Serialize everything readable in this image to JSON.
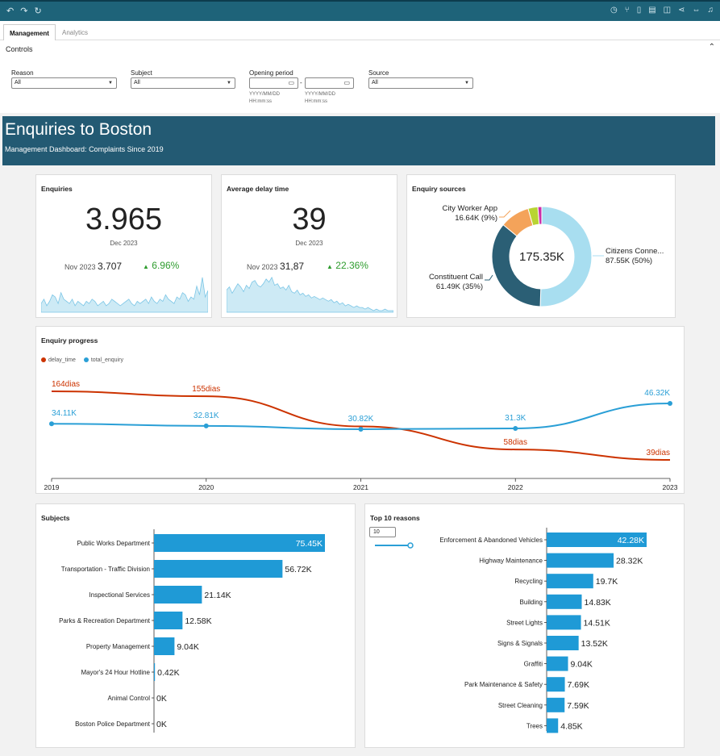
{
  "toolbar": {
    "left_icons": [
      "undo-icon",
      "redo-icon",
      "refresh-icon"
    ],
    "right_icons": [
      "clock-icon",
      "branch-icon",
      "bookmark-icon",
      "file-icon",
      "database-icon",
      "share-icon",
      "fullwidth-icon",
      "bell-icon"
    ]
  },
  "tabs": [
    {
      "label": "Management"
    },
    {
      "label": "Analytics"
    }
  ],
  "controls": {
    "title": "Controls",
    "reason": {
      "label": "Reason",
      "value": "All"
    },
    "subject": {
      "label": "Subject",
      "value": "All"
    },
    "opening": {
      "label": "Opening period",
      "separator": "-",
      "hint1": "YYYY/MM/DD",
      "hint2": "HH:mm:ss"
    },
    "source": {
      "label": "Source",
      "value": "All"
    }
  },
  "banner": {
    "title": "Enquiries to Boston",
    "subtitle": "Management Dashboard: Complaints Since 2019"
  },
  "kpi_enquiries": {
    "title": "Enquiries",
    "value": "3.965",
    "period": "Dec 2023",
    "prev_period": "Nov 2023",
    "prev_value": "3.707",
    "delta": "6.96%",
    "spark": [
      4,
      6,
      3,
      5,
      8,
      7,
      4,
      9,
      6,
      5,
      4,
      6,
      3,
      5,
      4,
      3,
      5,
      4,
      6,
      5,
      3,
      4,
      5,
      3,
      4,
      6,
      5,
      4,
      3,
      4,
      5,
      6,
      4,
      3,
      5,
      4,
      5,
      6,
      4,
      7,
      5,
      4,
      6,
      5,
      8,
      6,
      5,
      4,
      7,
      6,
      9,
      8,
      5,
      7,
      6,
      12,
      8,
      16,
      7,
      10
    ]
  },
  "kpi_delay": {
    "title": "Average delay time",
    "value": "39",
    "period": "Dec 2023",
    "prev_period": "Nov 2023",
    "prev_value": "31,87",
    "delta": "22.36%",
    "spark": [
      14,
      16,
      12,
      15,
      18,
      16,
      13,
      17,
      15,
      19,
      20,
      17,
      16,
      18,
      21,
      19,
      22,
      17,
      18,
      15,
      16,
      14,
      17,
      13,
      12,
      14,
      11,
      12,
      10,
      11,
      9,
      10,
      9,
      8,
      9,
      8,
      7,
      8,
      6,
      7,
      5,
      6,
      4,
      5,
      4,
      3,
      4,
      3,
      3,
      2,
      3,
      2,
      1,
      2,
      1,
      1,
      2,
      1,
      1,
      1
    ]
  },
  "sources": {
    "title": "Enquiry sources",
    "total": "175.35K",
    "labels": [
      {
        "name": "City Worker App",
        "value": "16.64K (9%)"
      },
      {
        "name": "Constituent Call",
        "value": "61.49K (35%)"
      },
      {
        "name": "Citizens Conne...",
        "value": "87.55K (50%)"
      }
    ],
    "colors": [
      "#a8def0",
      "#2b5f75",
      "#f4a35a",
      "#b8d433",
      "#cc2ea8"
    ]
  },
  "progress": {
    "title": "Enquiry progress",
    "legend": [
      "delay_time",
      "total_enquiry"
    ],
    "x_labels": [
      "2019",
      "2020",
      "2021",
      "2022",
      "2023"
    ],
    "delay_labels": [
      "164dias",
      "155dias",
      "",
      "58dias",
      "39dias"
    ],
    "enquiry_labels": [
      "34.11K",
      "32.81K",
      "30.82K",
      "31.3K",
      "46.32K"
    ]
  },
  "subjects": {
    "title": "Subjects"
  },
  "reasons": {
    "title": "Top 10 reasons",
    "stepper": "10"
  },
  "chart_data": [
    {
      "type": "line",
      "title": "Enquiry progress",
      "x": [
        "2019",
        "2020",
        "2021",
        "2022",
        "2023"
      ],
      "series": [
        {
          "name": "delay_time",
          "unit": "dias",
          "values": [
            164,
            155,
            100,
            58,
            39
          ],
          "color": "#cc3300"
        },
        {
          "name": "total_enquiry",
          "values": [
            34.11,
            32.81,
            30.82,
            31.3,
            46.32
          ],
          "unit": "K",
          "color": "#2a9fd6"
        }
      ]
    },
    {
      "type": "pie",
      "title": "Enquiry sources",
      "categories": [
        "Citizens Conne...",
        "Constituent Call",
        "City Worker App",
        "",
        ""
      ],
      "values": [
        87.55,
        61.49,
        16.64,
        5.5,
        2.2
      ]
    },
    {
      "type": "bar",
      "title": "Subjects",
      "categories": [
        "Public Works Department",
        "Transportation - Traffic Division",
        "Inspectional Services",
        "Parks & Recreation Department",
        "Property Management",
        "Mayor's 24 Hour Hotline",
        "Animal Control",
        "Boston Police Department"
      ],
      "values": [
        75.45,
        56.72,
        21.14,
        12.58,
        9.04,
        0.42,
        0,
        0
      ],
      "labels": [
        "75.45K",
        "56.72K",
        "21.14K",
        "12.58K",
        "9.04K",
        "0.42K",
        "0K",
        "0K"
      ]
    },
    {
      "type": "bar",
      "title": "Top 10 reasons",
      "categories": [
        "Enforcement & Abandoned Vehicles",
        "Highway Maintenance",
        "Recycling",
        "Building",
        "Street Lights",
        "Signs & Signals",
        "Graffiti",
        "Park Maintenance & Safety",
        "Street Cleaning",
        "Trees"
      ],
      "values": [
        42.28,
        28.32,
        19.7,
        14.83,
        14.51,
        13.52,
        9.04,
        7.69,
        7.59,
        4.85
      ],
      "labels": [
        "42.28K",
        "28.32K",
        "19.7K",
        "14.83K",
        "14.51K",
        "13.52K",
        "9.04K",
        "7.69K",
        "7.59K",
        "4.85K"
      ]
    }
  ]
}
